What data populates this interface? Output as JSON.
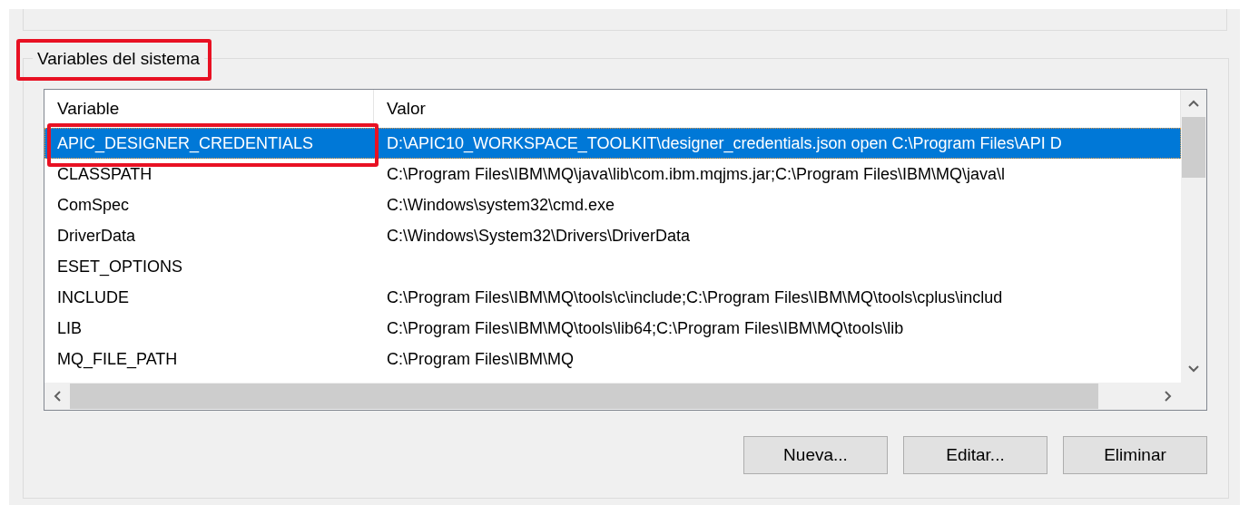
{
  "group": {
    "title": "Variables del sistema",
    "highlighted": true
  },
  "table": {
    "columns": [
      "Variable",
      "Valor"
    ],
    "rows": [
      {
        "variable": "APIC_DESIGNER_CREDENTIALS",
        "value": "D:\\APIC10_WORKSPACE_TOOLKIT\\designer_credentials.json open C:\\Program Files\\API D",
        "selected": true,
        "highlighted": true
      },
      {
        "variable": "CLASSPATH",
        "value": "C:\\Program Files\\IBM\\MQ\\java\\lib\\com.ibm.mqjms.jar;C:\\Program Files\\IBM\\MQ\\java\\l",
        "selected": false,
        "highlighted": false
      },
      {
        "variable": "ComSpec",
        "value": "C:\\Windows\\system32\\cmd.exe",
        "selected": false,
        "highlighted": false
      },
      {
        "variable": "DriverData",
        "value": "C:\\Windows\\System32\\Drivers\\DriverData",
        "selected": false,
        "highlighted": false
      },
      {
        "variable": "ESET_OPTIONS",
        "selected": false,
        "highlighted": false
      },
      {
        "variable": "INCLUDE",
        "value": "C:\\Program Files\\IBM\\MQ\\tools\\c\\include;C:\\Program Files\\IBM\\MQ\\tools\\cplus\\includ",
        "selected": false,
        "highlighted": false
      },
      {
        "variable": "LIB",
        "value": "C:\\Program Files\\IBM\\MQ\\tools\\lib64;C:\\Program Files\\IBM\\MQ\\tools\\lib",
        "selected": false,
        "highlighted": false
      },
      {
        "variable": "MQ_FILE_PATH",
        "value": "C:\\Program Files\\IBM\\MQ",
        "selected": false,
        "highlighted": false
      }
    ]
  },
  "buttons": [
    "Nueva...",
    "Editar...",
    "Eliminar"
  ]
}
